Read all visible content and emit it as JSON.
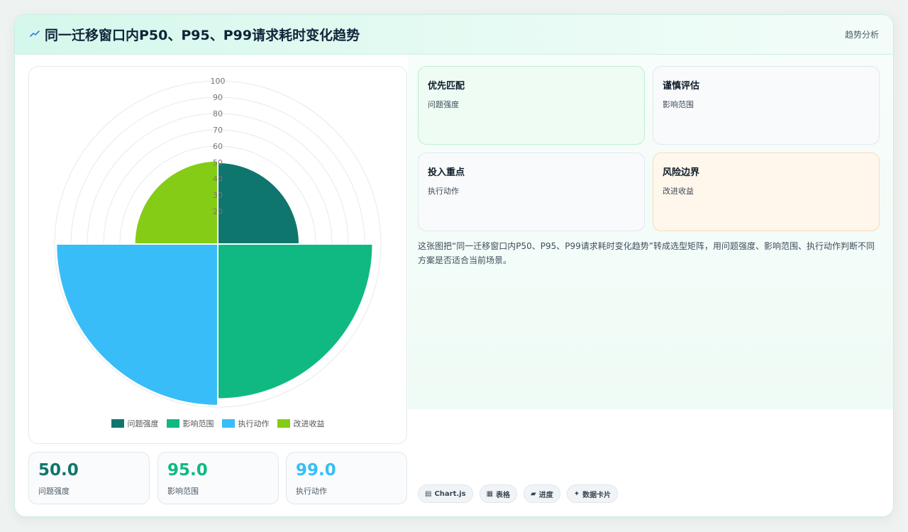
{
  "title": "同一迁移窗口内P50、P95、P99请求耗时变化趋势",
  "header_tag": "趋势分析",
  "colors": {
    "accent_teal": "#0f766e",
    "accent_green": "#10b981",
    "accent_blue": "#38bdf8",
    "accent_lime": "#84cc16"
  },
  "chart_data": {
    "type": "polarArea",
    "categories": [
      "问题强度",
      "影响范围",
      "执行动作",
      "改进收益"
    ],
    "values": [
      50,
      95,
      99,
      51
    ],
    "colors": [
      "#0f766e",
      "#10b981",
      "#38bdf8",
      "#84cc16"
    ],
    "r_ticks": [
      20,
      30,
      40,
      50,
      60,
      70,
      80,
      90,
      100
    ],
    "r_range": [
      0,
      100
    ],
    "legend_position": "bottom",
    "grid": true
  },
  "stats": [
    {
      "value": "50.0",
      "label": "问题强度",
      "color": "#0f766e"
    },
    {
      "value": "95.0",
      "label": "影响范围",
      "color": "#10b981"
    },
    {
      "value": "99.0",
      "label": "执行动作",
      "color": "#38bdf8"
    }
  ],
  "quadrants": [
    {
      "title": "优先匹配",
      "sub": "问题强度"
    },
    {
      "title": "谨慎评估",
      "sub": "影响范围"
    },
    {
      "title": "投入重点",
      "sub": "执行动作"
    },
    {
      "title": "风险边界",
      "sub": "改进收益"
    }
  ],
  "description": "这张图把“同一迁移窗口内P50、P95、P99请求耗时变化趋势”转成选型矩阵，用问题强度、影响范围、执行动作判断不同方案是否适合当前场景。",
  "tags": [
    {
      "icon": "▤",
      "label": "Chart.js"
    },
    {
      "icon": "▦",
      "label": "表格"
    },
    {
      "icon": "▰",
      "label": "进度"
    },
    {
      "icon": "✦",
      "label": "数据卡片"
    }
  ]
}
